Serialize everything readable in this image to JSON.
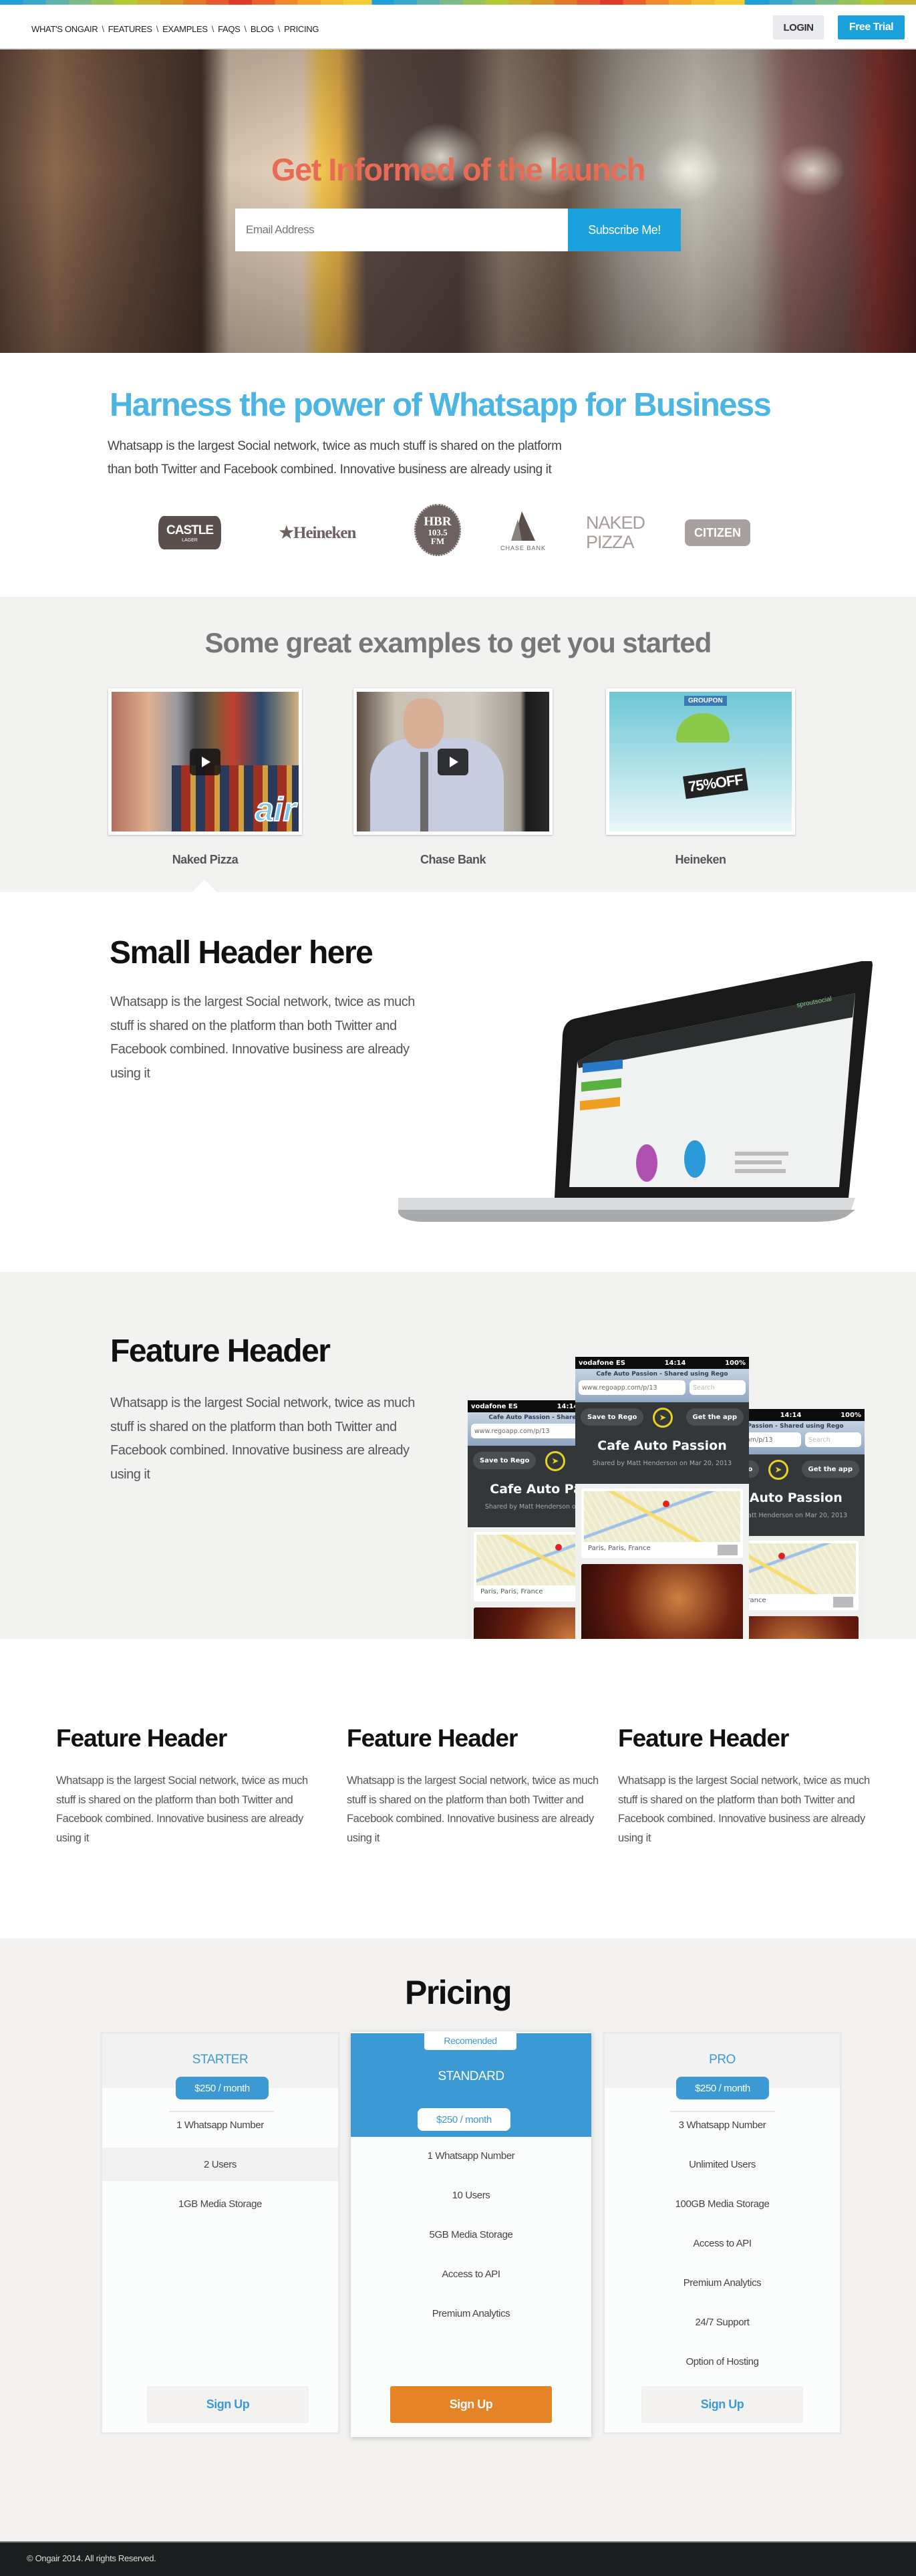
{
  "nav": {
    "items": [
      "WHAT'S ONGAIR",
      "FEATURES",
      "EXAMPLES",
      "FAQS",
      "BLOG",
      "PRICING"
    ],
    "separator": "\\",
    "login": "LOGIN",
    "free_trial": "Free Trial"
  },
  "hero": {
    "title": "Get Informed of the launch",
    "email_placeholder": "Email Address",
    "subscribe": "Subscribe Me!"
  },
  "intro": {
    "title": "Harness the power of Whatsapp for Business",
    "text_line1": "Whatsapp is the largest Social network, twice as much stuff is shared on the platform",
    "text_line2": "than both Twitter and Facebook combined. Innovative business are already using it",
    "logos": {
      "castle": "CASTLE",
      "castle_sub": "LAGER",
      "heineken": "★Heineken",
      "hbr": "HBR",
      "hbr_freq": "103.5",
      "hbr_fm": "FM",
      "chase": "CHASE BANK",
      "naked1": "NAKED",
      "naked2": "PIZZA",
      "citizen": "CITIZEN"
    }
  },
  "examples": {
    "title": "Some great examples to get you started",
    "items": [
      {
        "label": "Naked Pizza",
        "overlay": "air"
      },
      {
        "label": "Chase Bank"
      },
      {
        "label": "Heineken",
        "overlay": "75%OFF",
        "banner": "GROUPON"
      }
    ]
  },
  "showcase": {
    "title": "Small Header here",
    "text": "Whatsapp is the largest Social network, twice as much stuff is shared on the platform than both Twitter and Facebook combined. Innovative business are already using it",
    "screen_brand": "sproutsocial"
  },
  "feature": {
    "title": "Feature Header",
    "text": "Whatsapp is the largest Social network, twice as much stuff is shared on the platform than both Twitter and Facebook combined. Innovative business are already using it",
    "phone": {
      "carrier": "vodafone ES",
      "time": "14:14",
      "battery": "100%",
      "page_title": "Cafe Auto Passion - Shared using Rego",
      "url": "www.regoapp.com/p/13",
      "search": "Search",
      "save": "Save to Rego",
      "get_app": "Get the app",
      "place": "Cafe Auto Passion",
      "shared_by": "Shared by Matt Henderson on Mar 20, 2013",
      "location": "Paris, Paris, France"
    }
  },
  "features3": [
    {
      "title": "Feature Header",
      "text": "Whatsapp is the largest Social network, twice as much stuff is shared on the platform than both Twitter and Facebook combined. Innovative business are already using it"
    },
    {
      "title": "Feature Header",
      "text": "Whatsapp is the largest Social network, twice as much stuff is shared on the platform than both Twitter and Facebook combined. Innovative business are already using it"
    },
    {
      "title": "Feature Header",
      "text": "Whatsapp is the largest Social network, twice as much stuff is shared on the platform than both Twitter and Facebook combined. Innovative business are already using it"
    }
  ],
  "pricing": {
    "title": "Pricing",
    "recommended": "Recomended",
    "plans": [
      {
        "name": "STARTER",
        "price": "$250 / month",
        "features": [
          "1 Whatsapp Number",
          "2 Users",
          "1GB Media Storage"
        ],
        "cta": "Sign Up"
      },
      {
        "name": "STANDARD",
        "price": "$250 / month",
        "features": [
          "1 Whatsapp Number",
          "10 Users",
          "5GB Media Storage",
          "Access to API",
          "Premium Analytics"
        ],
        "cta": "Sign Up"
      },
      {
        "name": "PRO",
        "price": "$250 / month",
        "features": [
          "3 Whatsapp Number",
          "Unlimited Users",
          "100GB Media Storage",
          "Access to API",
          "Premium Analytics",
          "24/7 Support",
          "Option of Hosting"
        ],
        "cta": "Sign Up"
      }
    ]
  },
  "footer": {
    "text": "© Ongair 2014. All rights Reserved."
  },
  "colors": {
    "accent": "#1ba1dc",
    "heading_blue": "#4bb5e3",
    "hero_title": "#e86c55",
    "plan_blue": "#3b9ad4",
    "cta_orange": "#e58326",
    "footer": "#1c1f20"
  }
}
